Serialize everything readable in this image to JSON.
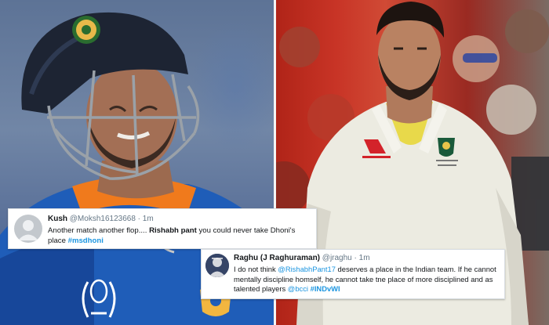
{
  "tweets": [
    {
      "name": "Kush",
      "handle": "@Moksh16123668",
      "sep": "·",
      "time": "1m",
      "body": {
        "t1": "Another match another flop.... ",
        "b1": "Rishabh pant",
        "t2": " you could never take Dhoni's place ",
        "h1": "#msdhoni"
      }
    },
    {
      "name": "Raghu (J Raghuraman)",
      "handle": "@jraghu",
      "sep": "·",
      "time": "1m",
      "body": {
        "t1": "I do not think ",
        "m1": "@RishabhPant17",
        "t2": " deserves a place in the Indian team. If he cannot mentally discipline homself, he cannot take tne place of more disciplined and as talented players ",
        "m2": "@bcci",
        "t3": " ",
        "h1": "#INDvWI"
      }
    }
  ],
  "colors": {
    "india_blue": "#1f5db8",
    "india_orange": "#f07a1c",
    "helmet_navy": "#1d2433",
    "aus_cream": "#ecebe1",
    "aus_collar_yellow": "#e8d94a",
    "crowd_red": "#c83426",
    "tweet_link": "#1b95e0"
  },
  "icons": [
    "bcci-crest-icon",
    "world-cup-trophy-icon",
    "bcci-badge-icon",
    "qantas-logo-icon",
    "cricket-australia-badge-icon",
    "default-avatar-icon"
  ]
}
